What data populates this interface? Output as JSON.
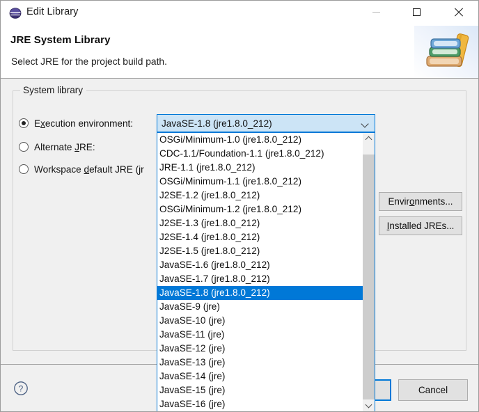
{
  "window": {
    "title": "Edit Library",
    "icon": "eclipse-logo-icon",
    "controls": {
      "minimize": "minimize-icon",
      "maximize": "maximize-icon",
      "close": "close-icon"
    }
  },
  "header": {
    "title": "JRE System Library",
    "subtitle": "Select JRE for the project build path.",
    "image": "books-stack-icon"
  },
  "group": {
    "legend": "System library",
    "options": [
      {
        "id": "execution-environment",
        "label_pre": "E",
        "label_mnemonic": "x",
        "label_post": "ecution environment:",
        "full_label": "Execution environment:",
        "checked": true
      },
      {
        "id": "alternate-jre",
        "label_pre": "Alternate ",
        "label_mnemonic": "J",
        "label_post": "RE:",
        "full_label": "Alternate JRE:",
        "checked": false
      },
      {
        "id": "workspace-default-jre",
        "label_pre": "Workspace ",
        "label_mnemonic": "d",
        "label_post": "efault JRE (jr",
        "full_label": "Workspace default JRE (jr",
        "checked": false
      }
    ]
  },
  "combo": {
    "selected_value": "JavaSE-1.8 (jre1.8.0_212)",
    "expanded": true,
    "arrow_icon": "chevron-down-icon",
    "items": [
      "OSGi/Minimum-1.0 (jre1.8.0_212)",
      "CDC-1.1/Foundation-1.1 (jre1.8.0_212)",
      "JRE-1.1 (jre1.8.0_212)",
      "OSGi/Minimum-1.1 (jre1.8.0_212)",
      "J2SE-1.2 (jre1.8.0_212)",
      "OSGi/Minimum-1.2 (jre1.8.0_212)",
      "J2SE-1.3 (jre1.8.0_212)",
      "J2SE-1.4 (jre1.8.0_212)",
      "J2SE-1.5 (jre1.8.0_212)",
      "JavaSE-1.6 (jre1.8.0_212)",
      "JavaSE-1.7 (jre1.8.0_212)",
      "JavaSE-1.8 (jre1.8.0_212)",
      "JavaSE-9 (jre)",
      "JavaSE-10 (jre)",
      "JavaSE-11 (jre)",
      "JavaSE-12 (jre)",
      "JavaSE-13 (jre)",
      "JavaSE-14 (jre)",
      "JavaSE-15 (jre)",
      "JavaSE-16 (jre)"
    ],
    "selected_index": 11,
    "scrollbar": {
      "up_icon": "chevron-up-icon",
      "down_icon": "chevron-down-icon"
    }
  },
  "side_buttons": [
    {
      "id": "environments",
      "pre": "Envir",
      "mnemonic": "o",
      "post": "nments...",
      "full_label": "Environments..."
    },
    {
      "id": "installed-jres",
      "pre": "",
      "mnemonic": "I",
      "post": "nstalled JREs...",
      "full_label": "Installed JREs..."
    }
  ],
  "footer": {
    "help_icon": "help-question-icon",
    "finish_label": "",
    "cancel_label": "Cancel"
  },
  "colors": {
    "accent": "#0078d7",
    "combo_fill": "#cce4f6",
    "body": "#f0f0f0",
    "button_face": "#e1e1e1"
  }
}
